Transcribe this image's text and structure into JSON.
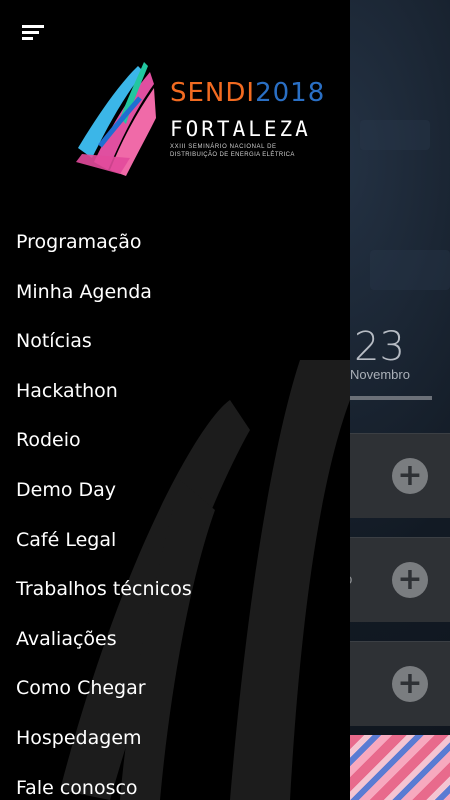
{
  "background": {
    "date": {
      "day": "23",
      "month": "Novembro"
    },
    "cards": [
      {
        "action_icon": "plus-icon"
      },
      {
        "action_icon": "plus-icon",
        "text_fragment": "o"
      },
      {
        "action_icon": "plus-icon"
      }
    ]
  },
  "drawer": {
    "menu_icon": "hamburger-menu-icon",
    "logo": {
      "event": "SENDI",
      "year": "2018",
      "city": "FORTALEZA",
      "subtitle_line1": "XXIII SEMINÁRIO NACIONAL DE",
      "subtitle_line2": "DISTRIBUIÇÃO DE ENERGIA ELÉTRICA"
    },
    "menu_items": [
      {
        "label": "Programação"
      },
      {
        "label": "Minha Agenda"
      },
      {
        "label": "Notícias"
      },
      {
        "label": "Hackathon"
      },
      {
        "label": "Rodeio"
      },
      {
        "label": "Demo Day"
      },
      {
        "label": "Café Legal"
      },
      {
        "label": "Trabalhos técnicos"
      },
      {
        "label": "Avaliações"
      },
      {
        "label": "Como Chegar"
      },
      {
        "label": "Hospedagem"
      },
      {
        "label": "Fale conosco"
      }
    ]
  },
  "colors": {
    "drawer_bg": "#000000",
    "logo_orange": "#f26b21",
    "logo_blue": "#2a6fc4",
    "menu_text": "#ffffff"
  }
}
